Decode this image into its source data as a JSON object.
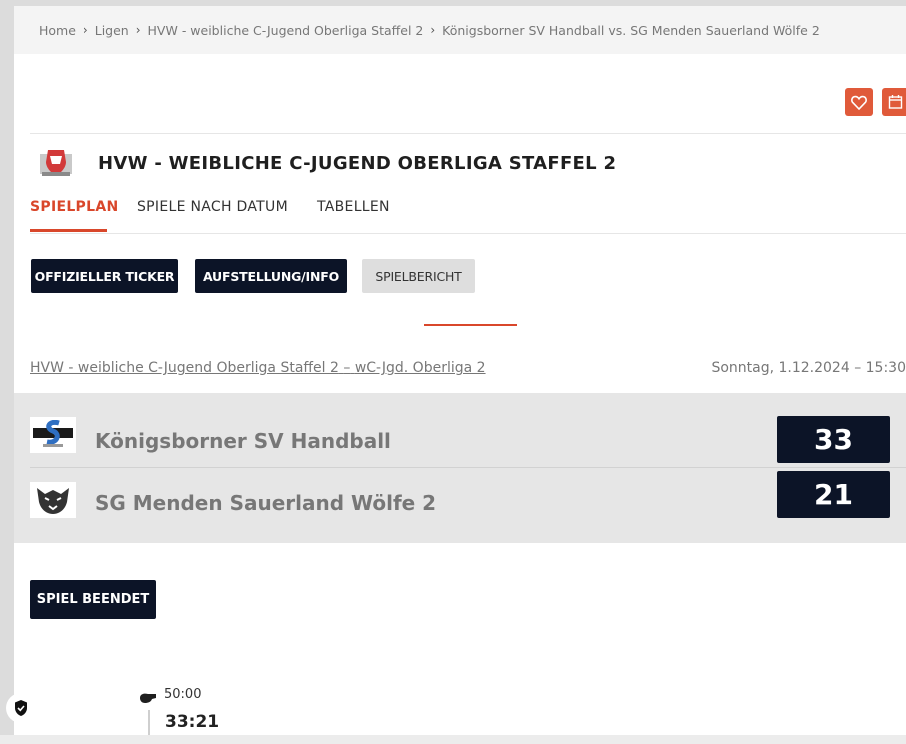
{
  "breadcrumb": [
    "Home",
    "Ligen",
    "HVW - weibliche C-Jugend Oberliga Staffel 2",
    "Königsborner SV Handball vs. SG Menden Sauerland Wölfe 2"
  ],
  "league": {
    "title": "HVW - WEIBLICHE C-JUGEND OBERLIGA STAFFEL 2",
    "logo_icon": "league-crest-icon"
  },
  "tabs": [
    {
      "label": "SPIELPLAN",
      "active": true
    },
    {
      "label": "SPIELE NACH DATUM",
      "active": false
    },
    {
      "label": "TABELLEN",
      "active": false
    }
  ],
  "actions": {
    "favorite_icon": "heart-icon",
    "calendar_icon": "calendar-add-icon",
    "accent": "#e05a3a"
  },
  "buttons": {
    "ticker": "OFFIZIELLER TICKER",
    "lineup": "AUFSTELLUNG/INFO",
    "report": "SPIELBERICHT"
  },
  "match": {
    "league_link": "HVW - weibliche C-Jugend Oberliga Staffel 2",
    "group_sep": "–",
    "group_link": "wC-Jgd. Oberliga 2",
    "date": "Sonntag, 1.12.2024 – 15:30",
    "home": {
      "name": "Königsborner SV Handball",
      "score": "33"
    },
    "away": {
      "name": "SG Menden Sauerland Wölfe 2",
      "score": "21"
    },
    "status": "SPIEL BEENDET"
  },
  "timeline": [
    {
      "time": "50:00",
      "score": "33:21",
      "icon": "whistle-icon"
    }
  ],
  "colors": {
    "dark": "#0c1427",
    "accent": "#d9472b"
  }
}
